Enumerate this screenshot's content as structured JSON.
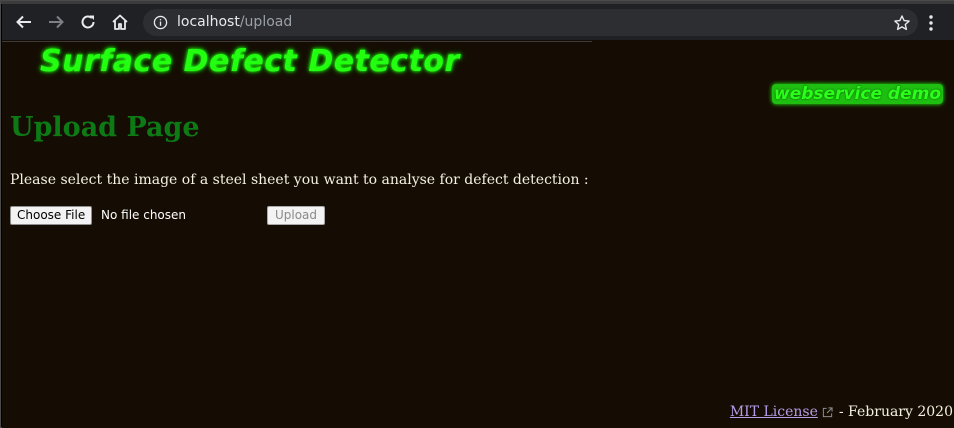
{
  "browser": {
    "url_host": "localhost",
    "url_path": "/upload"
  },
  "header": {
    "logo_text": "Surface Defect Detector",
    "badge_text": "webservice demo"
  },
  "main": {
    "title": "Upload Page",
    "instruction": "Please select the image of a steel sheet you want to analyse for defect detection :",
    "choose_file_label": "Choose File",
    "file_status": "No file chosen",
    "upload_label": "Upload"
  },
  "footer": {
    "license_link": "MIT License",
    "date_text": "- February 2020"
  },
  "colors": {
    "background": "#150d03",
    "logo_green": "#22ff11",
    "title_green": "#0d7a15",
    "link": "#b59ce9"
  }
}
